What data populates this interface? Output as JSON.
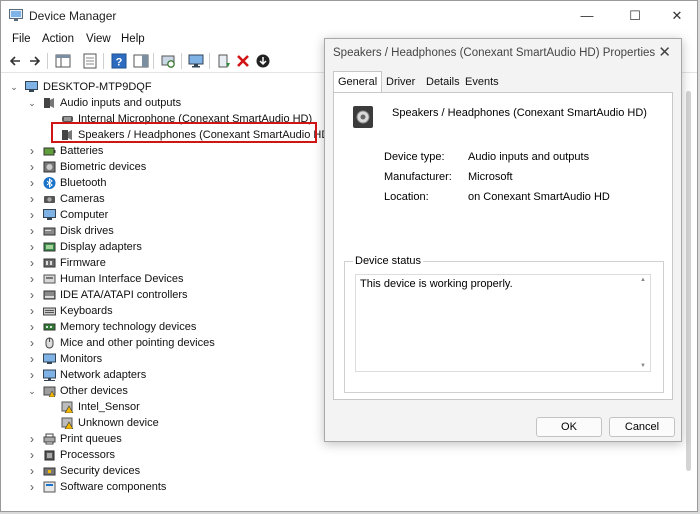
{
  "window": {
    "title": "Device Manager",
    "controls": {
      "minimize": "—",
      "maximize": "☐",
      "close": "✕"
    }
  },
  "menu": [
    "File",
    "Action",
    "View",
    "Help"
  ],
  "tree": {
    "root": "DESKTOP-MTP9DQF",
    "items": [
      {
        "label": "Audio inputs and outputs",
        "level": 1,
        "expanded": true,
        "icon": "speaker-icon"
      },
      {
        "label": "Internal Microphone (Conexant SmartAudio HD)",
        "level": 2,
        "icon": "microphone-icon"
      },
      {
        "label": "Speakers / Headphones (Conexant SmartAudio HD)",
        "level": 2,
        "icon": "speaker-icon",
        "selected": true
      },
      {
        "label": "Batteries",
        "level": 1,
        "icon": "battery-icon"
      },
      {
        "label": "Biometric devices",
        "level": 1,
        "icon": "biometric-icon"
      },
      {
        "label": "Bluetooth",
        "level": 1,
        "icon": "bluetooth-icon"
      },
      {
        "label": "Cameras",
        "level": 1,
        "icon": "camera-icon"
      },
      {
        "label": "Computer",
        "level": 1,
        "icon": "computer-icon"
      },
      {
        "label": "Disk drives",
        "level": 1,
        "icon": "disk-icon"
      },
      {
        "label": "Display adapters",
        "level": 1,
        "icon": "display-icon"
      },
      {
        "label": "Firmware",
        "level": 1,
        "icon": "firmware-icon"
      },
      {
        "label": "Human Interface Devices",
        "level": 1,
        "icon": "hid-icon"
      },
      {
        "label": "IDE ATA/ATAPI controllers",
        "level": 1,
        "icon": "ide-icon"
      },
      {
        "label": "Keyboards",
        "level": 1,
        "icon": "keyboard-icon"
      },
      {
        "label": "Memory technology devices",
        "level": 1,
        "icon": "memory-icon"
      },
      {
        "label": "Mice and other pointing devices",
        "level": 1,
        "icon": "mouse-icon"
      },
      {
        "label": "Monitors",
        "level": 1,
        "icon": "monitor-icon"
      },
      {
        "label": "Network adapters",
        "level": 1,
        "icon": "network-icon"
      },
      {
        "label": "Other devices",
        "level": 1,
        "expanded": true,
        "icon": "other-devices-icon"
      },
      {
        "label": "Intel_Sensor",
        "level": 2,
        "icon": "warning-icon"
      },
      {
        "label": "Unknown device",
        "level": 2,
        "icon": "warning-icon"
      },
      {
        "label": "Print queues",
        "level": 1,
        "icon": "printer-icon"
      },
      {
        "label": "Processors",
        "level": 1,
        "icon": "processor-icon"
      },
      {
        "label": "Security devices",
        "level": 1,
        "icon": "security-icon"
      },
      {
        "label": "Software components",
        "level": 1,
        "icon": "software-icon"
      }
    ]
  },
  "properties": {
    "title": "Speakers / Headphones (Conexant SmartAudio HD) Properties",
    "tabs": [
      "General",
      "Driver",
      "Details",
      "Events"
    ],
    "active_tab": "General",
    "device_name": "Speakers / Headphones (Conexant SmartAudio HD)",
    "fields": [
      {
        "key": "Device type:",
        "value": "Audio inputs and outputs"
      },
      {
        "key": "Manufacturer:",
        "value": "Microsoft"
      },
      {
        "key": "Location:",
        "value": "on Conexant SmartAudio HD"
      }
    ],
    "status_label": "Device status",
    "status_text": "This device is working properly.",
    "ok_label": "OK",
    "cancel_label": "Cancel"
  },
  "colors": {
    "highlight_border": "#d01515",
    "accent": "#1a73c8",
    "warning": "#f2b705"
  }
}
